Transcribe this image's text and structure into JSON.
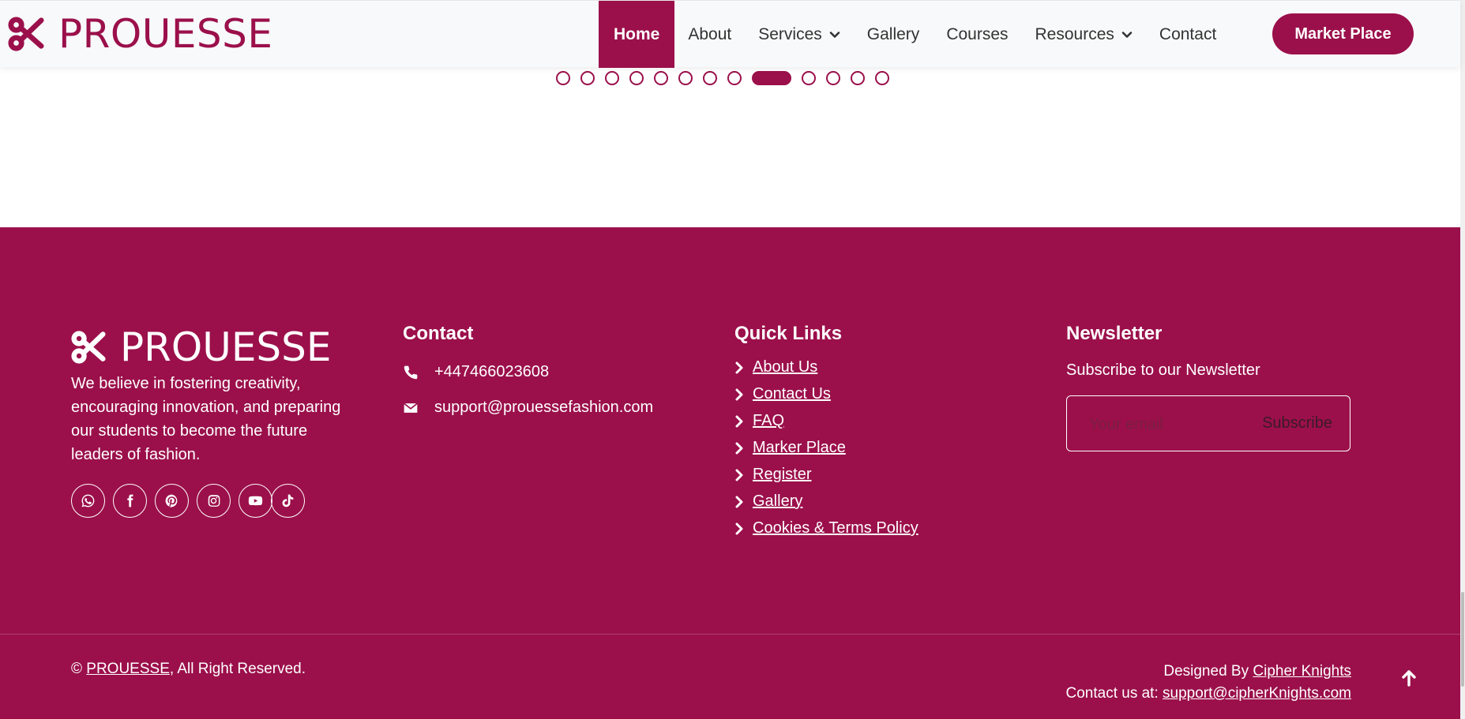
{
  "header": {
    "brand": "PROUESSE",
    "nav": [
      {
        "label": "Home",
        "active": true
      },
      {
        "label": "About"
      },
      {
        "label": "Services",
        "dropdown": true
      },
      {
        "label": "Gallery"
      },
      {
        "label": "Courses"
      },
      {
        "label": "Resources",
        "dropdown": true
      },
      {
        "label": "Contact"
      }
    ],
    "market_button": "Market Place"
  },
  "carousel": {
    "dot_count": 13,
    "active_index": 8
  },
  "footer": {
    "brand": "PROUESSE",
    "about": "We believe in fostering creativity, encouraging innovation, and preparing our students to become the future leaders of fashion.",
    "socials": [
      "whatsapp-icon",
      "facebook-icon",
      "pinterest-icon",
      "instagram-icon",
      "youtube-icon",
      "tiktok-icon"
    ],
    "contact": {
      "title": "Contact",
      "phone": "+447466023608",
      "email": "support@prouessefashion.com"
    },
    "quick_links": {
      "title": "Quick Links",
      "items": [
        "About Us",
        "Contact Us",
        "FAQ",
        "Marker Place",
        "Register",
        "Gallery",
        "Cookies & Terms Policy"
      ]
    },
    "newsletter": {
      "title": "Newsletter",
      "subtitle": "Subscribe to our Newsletter",
      "placeholder": "Your email",
      "button": "Subscribe"
    },
    "bottom": {
      "copyright_symbol": "©",
      "copyright_brand": "PROUESSE",
      "copyright_suffix": ", All Right Reserved.",
      "designed_by": "Designed By ",
      "designer": "Cipher Knights",
      "contact_prefix": "Contact us at: ",
      "contact_email": "support@cipherKnights.com"
    }
  },
  "colors": {
    "brand": "#9b104b",
    "header_bg": "#f8f9fa",
    "text_light": "#ffffff"
  }
}
